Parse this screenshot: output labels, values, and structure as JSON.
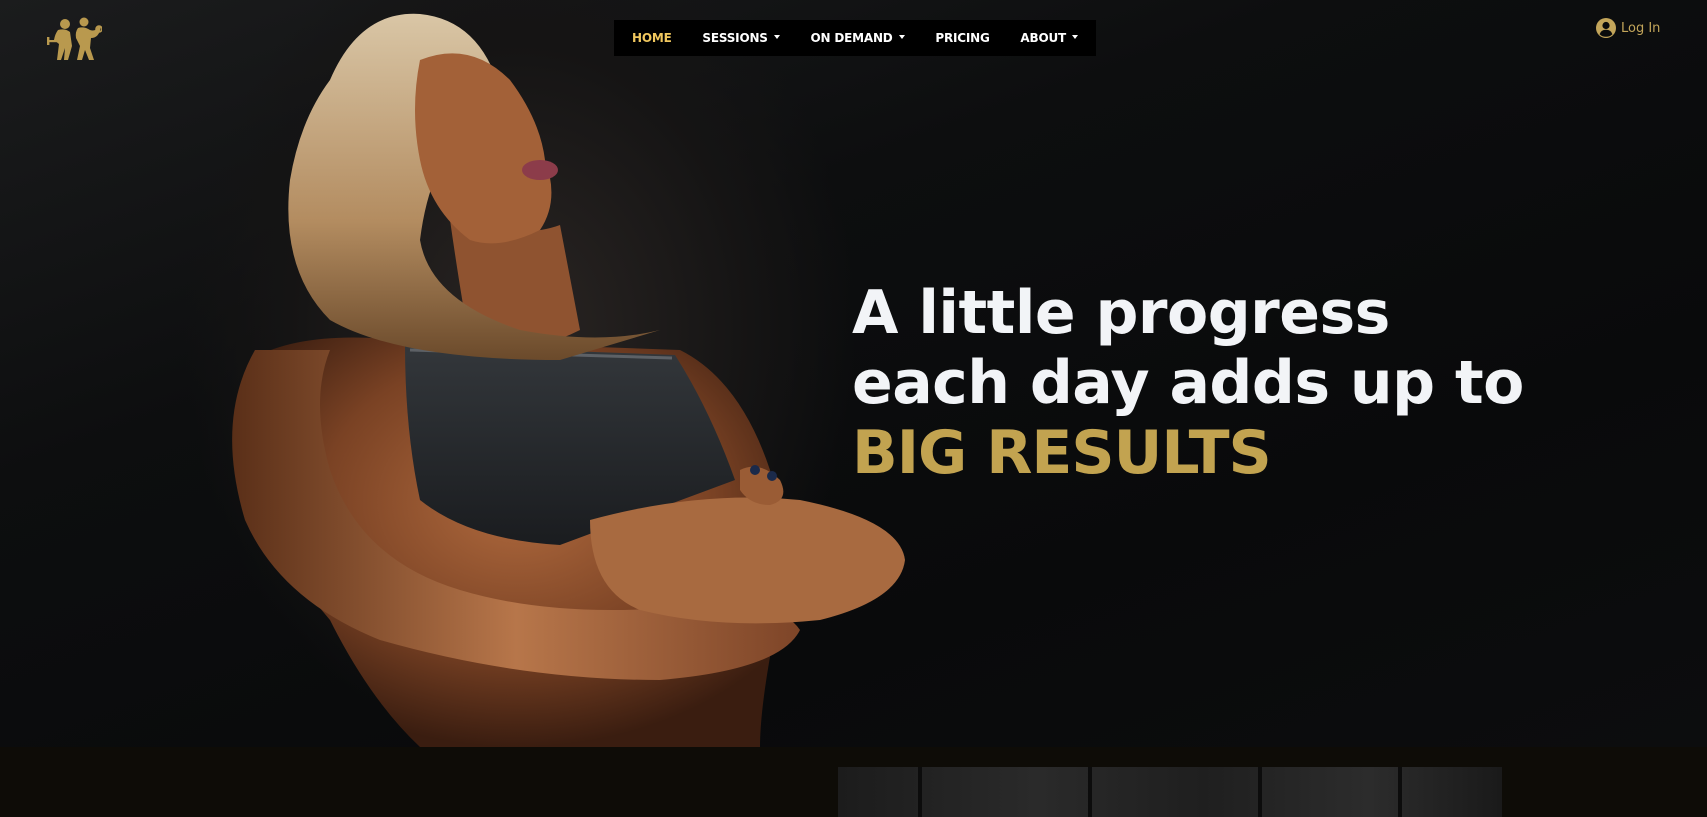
{
  "brand": {
    "logo_icon": "fitness-couple-logo-icon",
    "accent_color": "#c2a350",
    "active_nav_color": "#f0c75e"
  },
  "nav": {
    "items": [
      {
        "label": "HOME",
        "active": true,
        "dropdown": false
      },
      {
        "label": "SESSIONS",
        "active": false,
        "dropdown": true
      },
      {
        "label": "ON DEMAND",
        "active": false,
        "dropdown": true
      },
      {
        "label": "PRICING",
        "active": false,
        "dropdown": false
      },
      {
        "label": "ABOUT",
        "active": false,
        "dropdown": true
      }
    ]
  },
  "account": {
    "login_label": "Log In",
    "icon": "user-circle-icon"
  },
  "hero": {
    "line1": "A little progress",
    "line2": "each day adds up to",
    "accent": "BIG RESULTS"
  }
}
